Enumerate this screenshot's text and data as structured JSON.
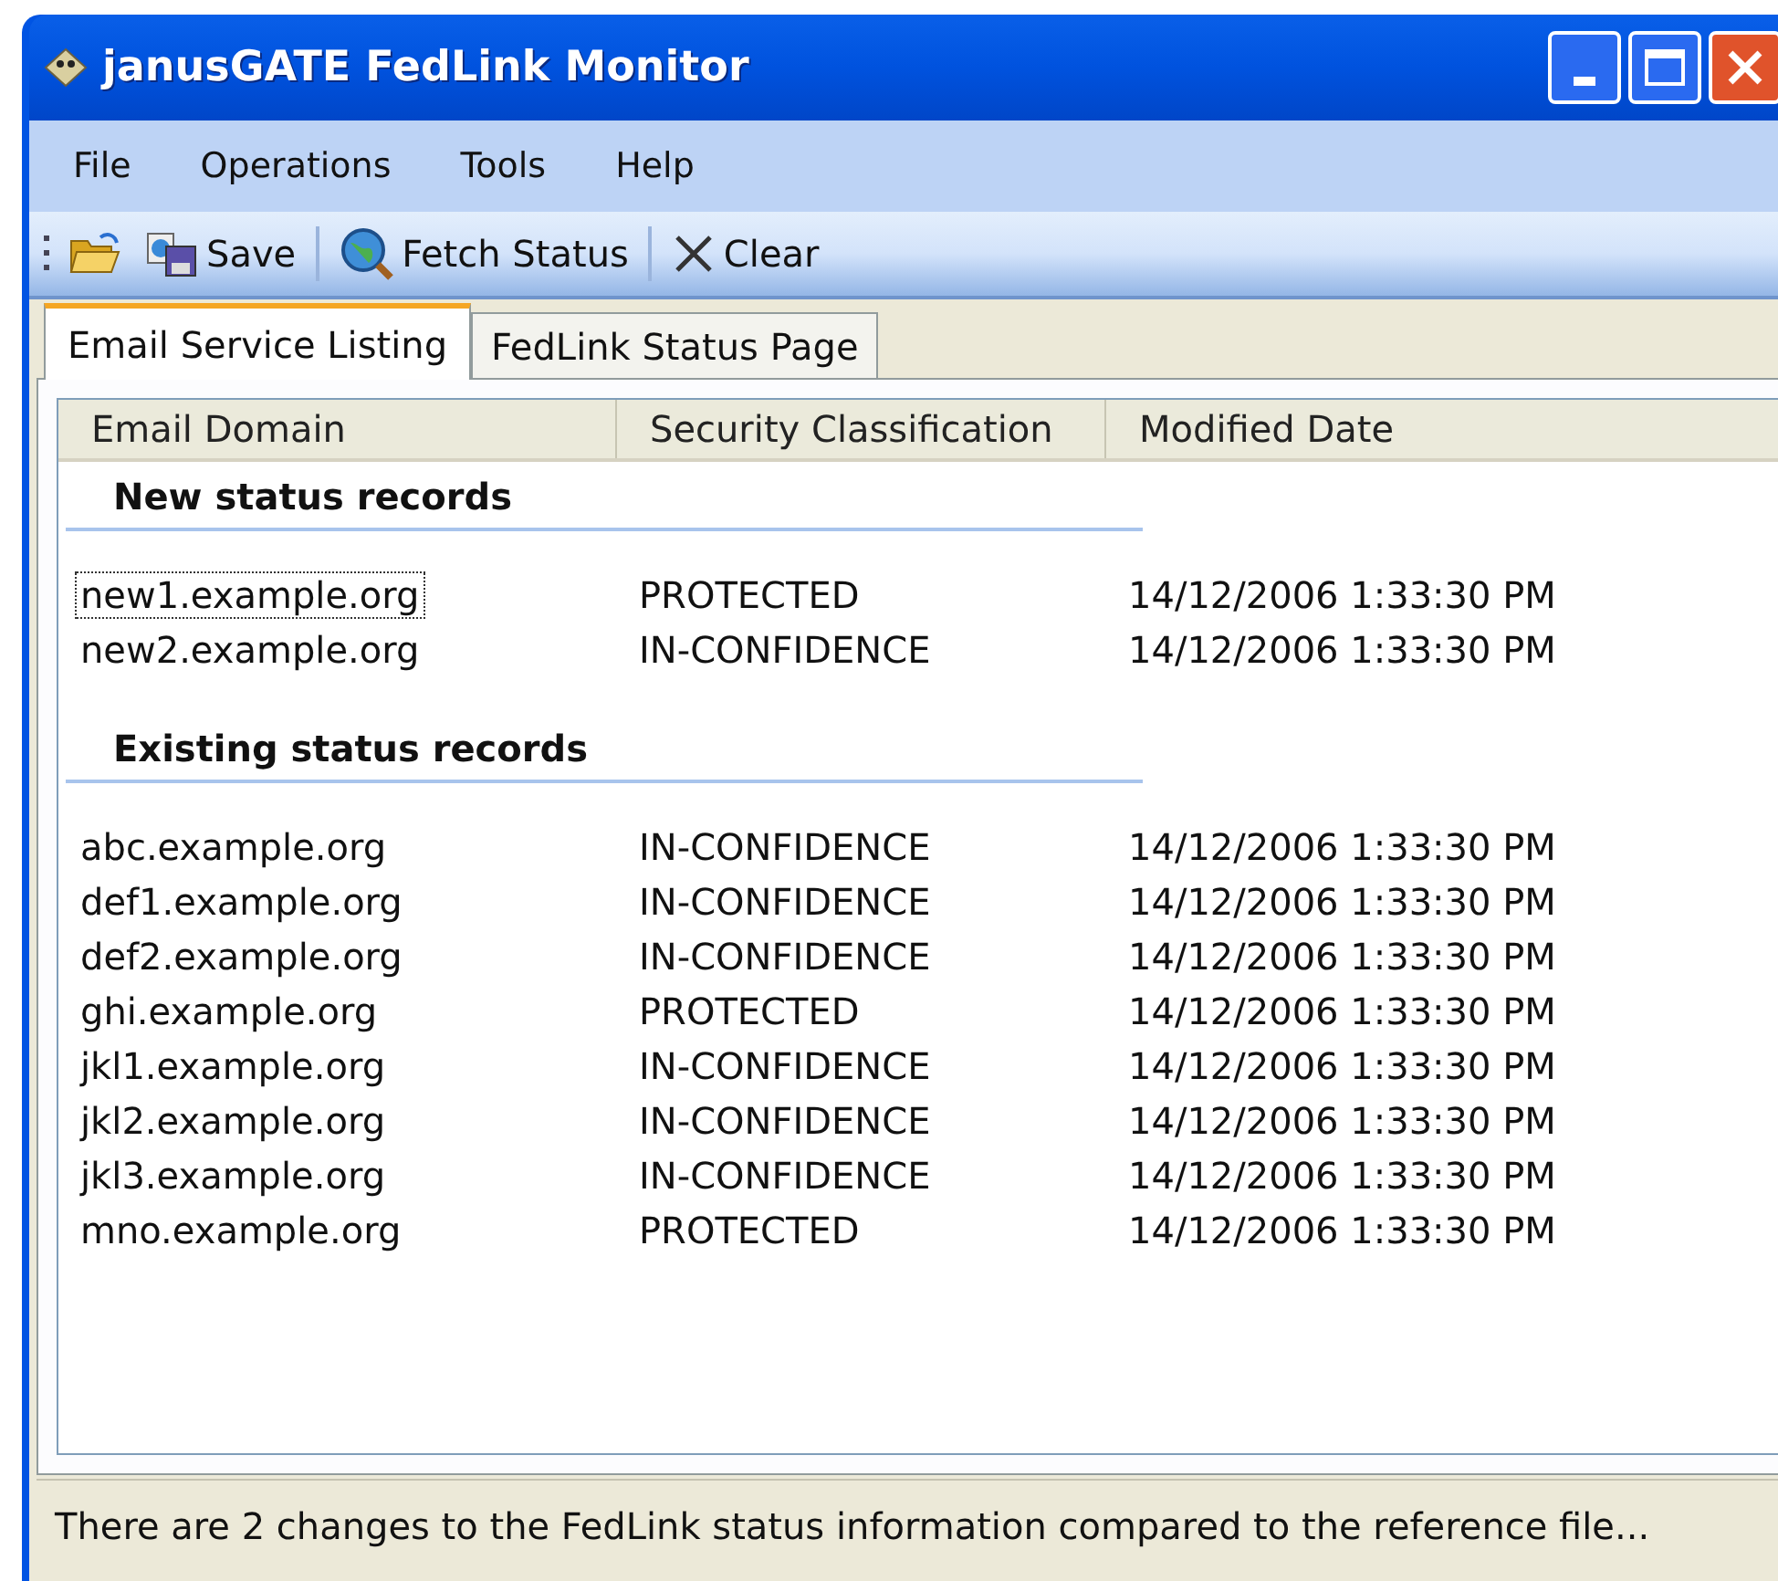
{
  "window": {
    "title": "janusGATE FedLink Monitor"
  },
  "menu": [
    {
      "label": "File"
    },
    {
      "label": "Operations"
    },
    {
      "label": "Tools"
    },
    {
      "label": "Help"
    }
  ],
  "toolbar": [
    {
      "kind": "open"
    },
    {
      "kind": "save",
      "label": "Save"
    },
    {
      "kind": "separator"
    },
    {
      "kind": "fetch",
      "label": "Fetch Status"
    },
    {
      "kind": "separator"
    },
    {
      "kind": "clear",
      "label": "Clear"
    }
  ],
  "tabs": [
    {
      "label": "Email Service Listing",
      "selected": true
    },
    {
      "label": "FedLink Status Page",
      "selected": false
    }
  ],
  "table": {
    "columns": [
      "Email Domain",
      "Security Classification",
      "Modified Date"
    ],
    "groups": [
      {
        "title": "New status records",
        "rows": [
          {
            "cells": [
              "new1.example.org",
              "PROTECTED",
              "14/12/2006 1:33:30 PM"
            ],
            "focused": true
          },
          {
            "cells": [
              "new2.example.org",
              "IN-CONFIDENCE",
              "14/12/2006 1:33:30 PM"
            ],
            "focused": false
          }
        ]
      },
      {
        "title": "Existing status records",
        "rows": [
          {
            "cells": [
              "abc.example.org",
              "IN-CONFIDENCE",
              "14/12/2006 1:33:30 PM"
            ],
            "focused": false
          },
          {
            "cells": [
              "def1.example.org",
              "IN-CONFIDENCE",
              "14/12/2006 1:33:30 PM"
            ],
            "focused": false
          },
          {
            "cells": [
              "def2.example.org",
              "IN-CONFIDENCE",
              "14/12/2006 1:33:30 PM"
            ],
            "focused": false
          },
          {
            "cells": [
              "ghi.example.org",
              "PROTECTED",
              "14/12/2006 1:33:30 PM"
            ],
            "focused": false
          },
          {
            "cells": [
              "jkl1.example.org",
              "IN-CONFIDENCE",
              "14/12/2006 1:33:30 PM"
            ],
            "focused": false
          },
          {
            "cells": [
              "jkl2.example.org",
              "IN-CONFIDENCE",
              "14/12/2006 1:33:30 PM"
            ],
            "focused": false
          },
          {
            "cells": [
              "jkl3.example.org",
              "IN-CONFIDENCE",
              "14/12/2006 1:33:30 PM"
            ],
            "focused": false
          },
          {
            "cells": [
              "mno.example.org",
              "PROTECTED",
              "14/12/2006 1:33:30 PM"
            ],
            "focused": false
          }
        ]
      }
    ]
  },
  "status_bar": "There are 2 changes to the FedLink status information compared to the reference file..."
}
